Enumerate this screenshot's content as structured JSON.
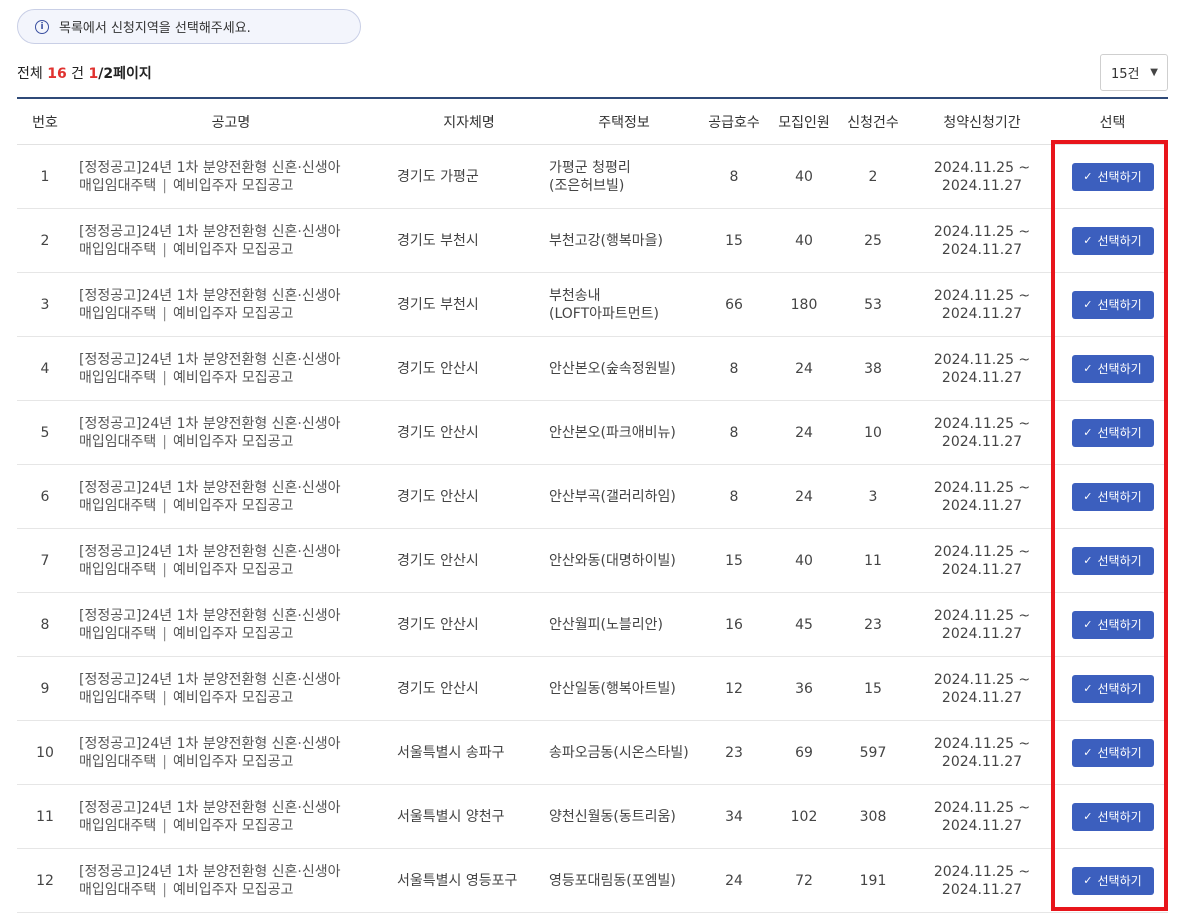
{
  "notice": {
    "text": "목록에서 신청지역을 선택해주세요."
  },
  "summary": {
    "prefix": "전체 ",
    "total": "16",
    "unit": " 건 ",
    "current_page": "1",
    "total_pages": "/2페이지"
  },
  "per_page": {
    "selected": "15건"
  },
  "table": {
    "headers": [
      "번호",
      "공고명",
      "지자체명",
      "주택정보",
      "공급호수",
      "모집인원",
      "신청건수",
      "청약신청기간",
      "선택"
    ],
    "button_label": "선택하기",
    "rows": [
      {
        "no": "1",
        "title1": "[정정공고]24년 1차 분양전환형 신혼·신생아",
        "title2a": "매입임대주택",
        "title2b": "예비입주자 모집공고",
        "region": "경기도 가평군",
        "house1": "가평군 청평리",
        "house2": "(조은허브빌)",
        "supply": "8",
        "recruit": "40",
        "applied": "2",
        "period1": "2024.11.25 ~",
        "period2": "2024.11.27"
      },
      {
        "no": "2",
        "title1": "[정정공고]24년 1차 분양전환형 신혼·신생아",
        "title2a": "매입임대주택",
        "title2b": "예비입주자 모집공고",
        "region": "경기도 부천시",
        "house1": "부천고강(행복마을)",
        "house2": "",
        "supply": "15",
        "recruit": "40",
        "applied": "25",
        "period1": "2024.11.25 ~",
        "period2": "2024.11.27"
      },
      {
        "no": "3",
        "title1": "[정정공고]24년 1차 분양전환형 신혼·신생아",
        "title2a": "매입임대주택",
        "title2b": "예비입주자 모집공고",
        "region": "경기도 부천시",
        "house1": "부천송내",
        "house2": "(LOFT아파트먼트)",
        "supply": "66",
        "recruit": "180",
        "applied": "53",
        "period1": "2024.11.25 ~",
        "period2": "2024.11.27"
      },
      {
        "no": "4",
        "title1": "[정정공고]24년 1차 분양전환형 신혼·신생아",
        "title2a": "매입임대주택",
        "title2b": "예비입주자 모집공고",
        "region": "경기도 안산시",
        "house1": "안산본오(숲속정원빌)",
        "house2": "",
        "supply": "8",
        "recruit": "24",
        "applied": "38",
        "period1": "2024.11.25 ~",
        "period2": "2024.11.27"
      },
      {
        "no": "5",
        "title1": "[정정공고]24년 1차 분양전환형 신혼·신생아",
        "title2a": "매입임대주택",
        "title2b": "예비입주자 모집공고",
        "region": "경기도 안산시",
        "house1": "안산본오(파크애비뉴)",
        "house2": "",
        "supply": "8",
        "recruit": "24",
        "applied": "10",
        "period1": "2024.11.25 ~",
        "period2": "2024.11.27"
      },
      {
        "no": "6",
        "title1": "[정정공고]24년 1차 분양전환형 신혼·신생아",
        "title2a": "매입임대주택",
        "title2b": "예비입주자 모집공고",
        "region": "경기도 안산시",
        "house1": "안산부곡(갤러리하임)",
        "house2": "",
        "supply": "8",
        "recruit": "24",
        "applied": "3",
        "period1": "2024.11.25 ~",
        "period2": "2024.11.27"
      },
      {
        "no": "7",
        "title1": "[정정공고]24년 1차 분양전환형 신혼·신생아",
        "title2a": "매입임대주택",
        "title2b": "예비입주자 모집공고",
        "region": "경기도 안산시",
        "house1": "안산와동(대명하이빌)",
        "house2": "",
        "supply": "15",
        "recruit": "40",
        "applied": "11",
        "period1": "2024.11.25 ~",
        "period2": "2024.11.27"
      },
      {
        "no": "8",
        "title1": "[정정공고]24년 1차 분양전환형 신혼·신생아",
        "title2a": "매입임대주택",
        "title2b": "예비입주자 모집공고",
        "region": "경기도 안산시",
        "house1": "안산월피(노블리안)",
        "house2": "",
        "supply": "16",
        "recruit": "45",
        "applied": "23",
        "period1": "2024.11.25 ~",
        "period2": "2024.11.27"
      },
      {
        "no": "9",
        "title1": "[정정공고]24년 1차 분양전환형 신혼·신생아",
        "title2a": "매입임대주택",
        "title2b": "예비입주자 모집공고",
        "region": "경기도 안산시",
        "house1": "안산일동(행복아트빌)",
        "house2": "",
        "supply": "12",
        "recruit": "36",
        "applied": "15",
        "period1": "2024.11.25 ~",
        "period2": "2024.11.27"
      },
      {
        "no": "10",
        "title1": "[정정공고]24년 1차 분양전환형 신혼·신생아",
        "title2a": "매입임대주택",
        "title2b": "예비입주자 모집공고",
        "region": "서울특별시 송파구",
        "house1": "송파오금동(시온스타빌)",
        "house2": "",
        "supply": "23",
        "recruit": "69",
        "applied": "597",
        "period1": "2024.11.25 ~",
        "period2": "2024.11.27"
      },
      {
        "no": "11",
        "title1": "[정정공고]24년 1차 분양전환형 신혼·신생아",
        "title2a": "매입임대주택",
        "title2b": "예비입주자 모집공고",
        "region": "서울특별시 양천구",
        "house1": "양천신월동(동트리움)",
        "house2": "",
        "supply": "34",
        "recruit": "102",
        "applied": "308",
        "period1": "2024.11.25 ~",
        "period2": "2024.11.27"
      },
      {
        "no": "12",
        "title1": "[정정공고]24년 1차 분양전환형 신혼·신생아",
        "title2a": "매입임대주택",
        "title2b": "예비입주자 모집공고",
        "region": "서울특별시 영등포구",
        "house1": "영등포대림동(포엠빌)",
        "house2": "",
        "supply": "24",
        "recruit": "72",
        "applied": "191",
        "period1": "2024.11.25 ~",
        "period2": "2024.11.27"
      }
    ]
  }
}
